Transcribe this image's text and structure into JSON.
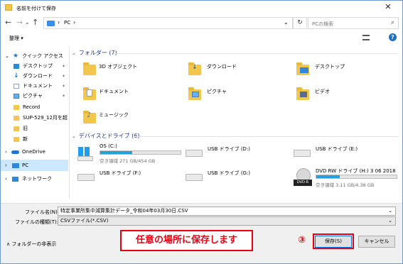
{
  "window": {
    "title": "名前を付けて保存",
    "close": "✕"
  },
  "nav": {
    "back": "←",
    "forward": "→",
    "dropdown": "⌄",
    "up": "↑",
    "path_sep": "›",
    "path": "PC",
    "refresh": "↻",
    "search_placeholder": "PCの検索",
    "search_icon": "⌕"
  },
  "cmd": {
    "organize": "整理 ▾",
    "help": "?"
  },
  "sidebar": {
    "items": [
      {
        "label": "クイック アクセス",
        "pinned": false
      },
      {
        "label": "デスクトップ",
        "pinned": true
      },
      {
        "label": "ダウンロード",
        "pinned": true
      },
      {
        "label": "ドキュメント",
        "pinned": true
      },
      {
        "label": "ピクチャ",
        "pinned": true
      },
      {
        "label": "Record",
        "pinned": false
      },
      {
        "label": "SUP-529_12月を超え",
        "pinned": false
      },
      {
        "label": "旧",
        "pinned": false
      },
      {
        "label": "新",
        "pinned": false
      },
      {
        "label": "OneDrive",
        "pinned": false
      },
      {
        "label": "PC",
        "pinned": false
      },
      {
        "label": "ネットワーク",
        "pinned": false
      }
    ],
    "pin_glyph": "✦"
  },
  "folders": {
    "header": "フォルダー (7)",
    "items": [
      "3D オブジェクト",
      "ダウンロード",
      "デスクトップ",
      "ドキュメント",
      "ピクチャ",
      "ビデオ",
      "ミュージック"
    ]
  },
  "drives": {
    "header": "デバイスとドライブ (6)",
    "items": [
      {
        "name": "OS (C:)",
        "free": "空き領域 271 GB/454 GB",
        "used_fraction": 0.4
      },
      {
        "name": "USB ドライブ (D:)",
        "free": "",
        "used_fraction": 0
      },
      {
        "name": "USB ドライブ (E:)",
        "free": "",
        "used_fraction": 0
      },
      {
        "name": "USB ドライブ (F:)",
        "free": "",
        "used_fraction": 0
      },
      {
        "name": "USB ドライブ (G:)",
        "free": "",
        "used_fraction": 0
      },
      {
        "name": "DVD RW ドライブ (H:) 3 06 2018",
        "free": "空き領域 3.11 GB/4.38 GB",
        "used_fraction": 0.29
      }
    ],
    "dvd_badge": "DVD-R"
  },
  "form": {
    "filename_label": "ファイル名(N):",
    "filename_value": "特定事業所集中減算集計データ_令和04年03月30日.CSV",
    "filetype_label": "ファイルの種類(T):",
    "filetype_value": "CSVファイル(*.CSV)",
    "dropdown_arrow": "⌄",
    "hide_folders": "∧ フォルダーの非表示",
    "save_button": "保存(S)",
    "cancel_button": "キャンセル"
  },
  "annotations": {
    "note": "任意の場所に保存します",
    "step": "③"
  },
  "colors": {
    "accent": "#26a0da",
    "annotation_red": "#e60012",
    "group_header": "#1e3287"
  }
}
